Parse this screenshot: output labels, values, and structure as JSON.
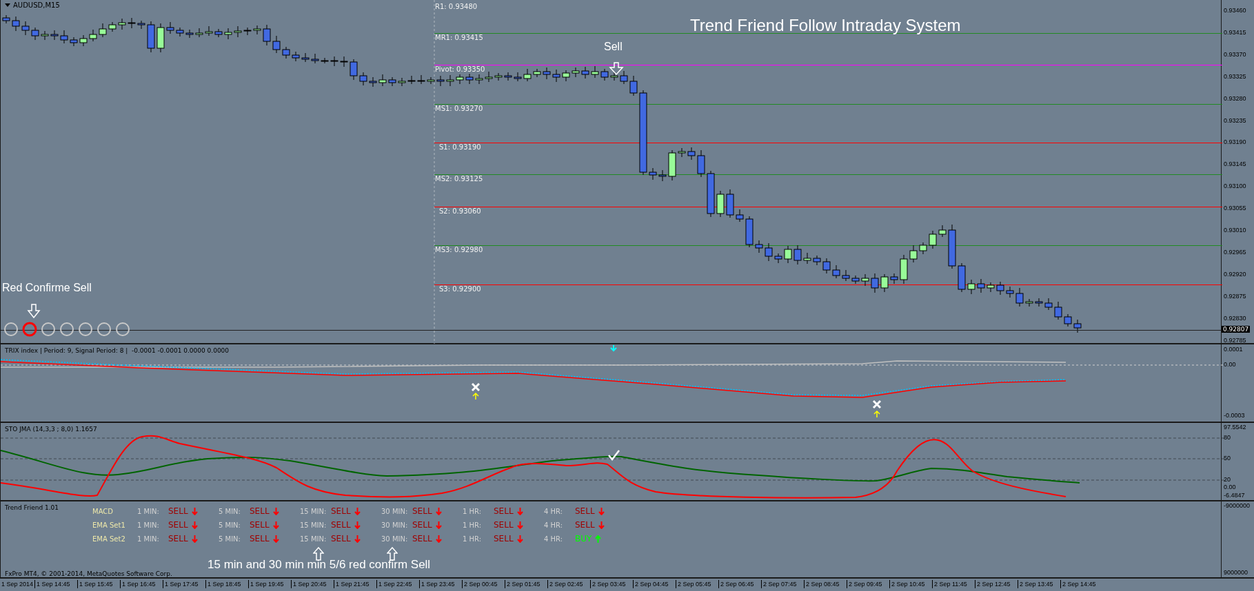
{
  "chart": {
    "symbol": "AUDUSD,M15",
    "title": "Trend Friend Follow Intraday System",
    "levels": [
      {
        "label": "R1: 0.93480"
      },
      {
        "label": "MR1: 0.93415",
        "color": "#228b22"
      },
      {
        "label": "Pivot: 0.93350",
        "color": "#ff00ff"
      },
      {
        "label": "MS1: 0.93270",
        "color": "#228b22"
      },
      {
        "label": "S1: 0.93190",
        "color": "#ff0000"
      },
      {
        "label": "MS2: 0.93125",
        "color": "#228b22"
      },
      {
        "label": "S2: 0.93060",
        "color": "#ff0000"
      },
      {
        "label": "MS3: 0.92980",
        "color": "#228b22"
      },
      {
        "label": "S3: 0.92900",
        "color": "#ff0000"
      }
    ],
    "sell_note": "Sell",
    "confirm_note": "Red Confirme Sell",
    "circles": [
      {
        "selected": false
      },
      {
        "selected": true
      },
      {
        "selected": false
      },
      {
        "selected": false
      },
      {
        "selected": false
      },
      {
        "selected": false
      },
      {
        "selected": false
      }
    ],
    "price_axis": [
      "0.93460",
      "0.93415",
      "0.93370",
      "0.93325",
      "0.93280",
      "0.93235",
      "0.93190",
      "0.93145",
      "0.93100",
      "0.93055",
      "0.93010",
      "0.92965",
      "0.92920",
      "0.92875",
      "0.92830",
      "0.92785"
    ],
    "current_price": "0.92807"
  },
  "trix": {
    "header": "TRIX index | Period: 9, Signal Period: 8 |  -0.0001 -0.0001 0.0000 0.0000",
    "axis": [
      "0.0001",
      "0.00",
      "-0.0003"
    ]
  },
  "sto": {
    "header": "STO JMA (14,3,3 ; 8,0) 1.1657",
    "axis": [
      "97.5542",
      "80",
      "50",
      "20",
      "0.00",
      "-6.4847"
    ]
  },
  "trend_friend": {
    "header": "Trend Friend 1.01",
    "rows": [
      {
        "name": "MACD",
        "cells": [
          {
            "label": "1 MIN:",
            "signal": "SELL",
            "kind": "sell"
          },
          {
            "label": "5 MIN:",
            "signal": "SELL",
            "kind": "sell"
          },
          {
            "label": "15 MIN:",
            "signal": "SELL",
            "kind": "sell"
          },
          {
            "label": "30 MIN:",
            "signal": "SELL",
            "kind": "sell"
          },
          {
            "label": "1 HR:",
            "signal": "SELL",
            "kind": "sell"
          },
          {
            "label": "4 HR:",
            "signal": "SELL",
            "kind": "sell"
          }
        ]
      },
      {
        "name": "EMA Set1",
        "cells": [
          {
            "label": "1 MIN:",
            "signal": "SELL",
            "kind": "sell"
          },
          {
            "label": "5 MIN:",
            "signal": "SELL",
            "kind": "sell"
          },
          {
            "label": "15 MIN:",
            "signal": "SELL",
            "kind": "sell"
          },
          {
            "label": "30 MIN:",
            "signal": "SELL",
            "kind": "sell"
          },
          {
            "label": "1 HR:",
            "signal": "SELL",
            "kind": "sell"
          },
          {
            "label": "4 HR:",
            "signal": "SELL",
            "kind": "sell"
          }
        ]
      },
      {
        "name": "EMA Set2",
        "cells": [
          {
            "label": "1 MIN:",
            "signal": "SELL",
            "kind": "sell"
          },
          {
            "label": "5 MIN:",
            "signal": "SELL",
            "kind": "sell"
          },
          {
            "label": "15 MIN:",
            "signal": "SELL",
            "kind": "sell"
          },
          {
            "label": "30 MIN:",
            "signal": "SELL",
            "kind": "sell"
          },
          {
            "label": "1 HR:",
            "signal": "SELL",
            "kind": "sell"
          },
          {
            "label": "4 HR:",
            "signal": "BUY",
            "kind": "buy"
          }
        ]
      }
    ],
    "note": "15 min and 30 min  min 5/6 red confirm Sell",
    "copyright": "FxPro MT4, © 2001-2014, MetaQuotes Software Corp.",
    "axis": [
      "-9000000",
      "9000000"
    ]
  },
  "time_axis": [
    "1 Sep 2014",
    "1 Sep 14:45",
    "1 Sep 15:45",
    "1 Sep 16:45",
    "1 Sep 17:45",
    "1 Sep 18:45",
    "1 Sep 19:45",
    "1 Sep 20:45",
    "1 Sep 21:45",
    "1 Sep 22:45",
    "1 Sep 23:45",
    "2 Sep 00:45",
    "2 Sep 01:45",
    "2 Sep 02:45",
    "2 Sep 03:45",
    "2 Sep 04:45",
    "2 Sep 05:45",
    "2 Sep 06:45",
    "2 Sep 07:45",
    "2 Sep 08:45",
    "2 Sep 09:45",
    "2 Sep 10:45",
    "2 Sep 11:45",
    "2 Sep 12:45",
    "2 Sep 13:45",
    "2 Sep 14:45"
  ]
}
